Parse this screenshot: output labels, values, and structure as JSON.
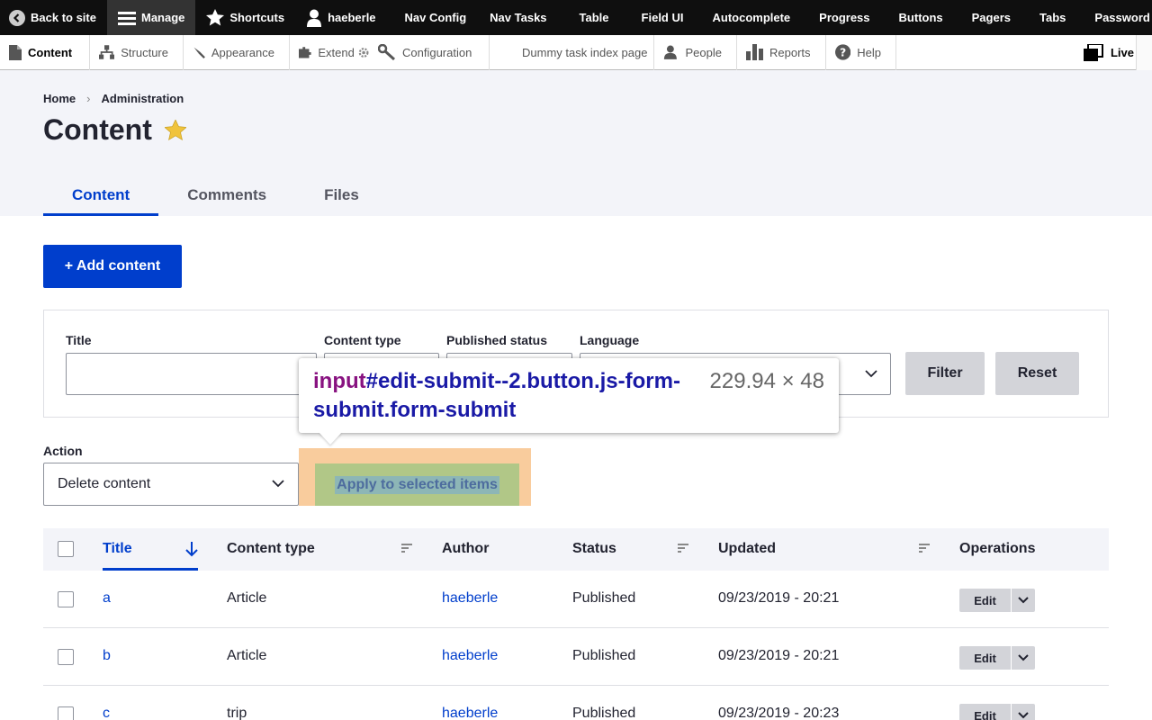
{
  "toolbar": {
    "back_to_site": "Back to site",
    "manage": "Manage",
    "shortcuts": "Shortcuts",
    "user": "haeberle",
    "nav_config": "Nav Config",
    "nav_tasks": "Nav Tasks",
    "table": "Table",
    "field_ui": "Field UI",
    "autocomplete": "Autocomplete",
    "progress": "Progress",
    "buttons": "Buttons",
    "pagers": "Pagers",
    "tabs": "Tabs",
    "password": "Password"
  },
  "tray": {
    "content": "Content",
    "structure": "Structure",
    "appearance": "Appearance",
    "extend": "Extend",
    "configuration": "Configuration",
    "dummy": "Dummy task index page",
    "people": "People",
    "reports": "Reports",
    "help": "Help",
    "live": "Live"
  },
  "breadcrumb": {
    "home": "Home",
    "sep": "›",
    "admin": "Administration"
  },
  "page_title": "Content",
  "tabs": {
    "content": "Content",
    "comments": "Comments",
    "files": "Files"
  },
  "add_content": "+ Add content",
  "filters": {
    "title_label": "Title",
    "type_label": "Content type",
    "status_label": "Published status",
    "language_label": "Language",
    "filter_btn": "Filter",
    "reset_btn": "Reset"
  },
  "action": {
    "label": "Action",
    "selected": "Delete content",
    "apply": "Apply to selected items"
  },
  "tooltip": {
    "tag": "input",
    "selector": "#edit-submit--2.button.js-form-submit.form-submit",
    "dimensions": "229.94 × 48"
  },
  "table": {
    "headers": {
      "title": "Title",
      "type": "Content type",
      "author": "Author",
      "status": "Status",
      "updated": "Updated",
      "operations": "Operations"
    },
    "rows": [
      {
        "title": "a",
        "type": "Article",
        "author": "haeberle",
        "status": "Published",
        "updated": "09/23/2019 - 20:21",
        "op": "Edit"
      },
      {
        "title": "b",
        "type": "Article",
        "author": "haeberle",
        "status": "Published",
        "updated": "09/23/2019 - 20:21",
        "op": "Edit"
      },
      {
        "title": "c",
        "type": "trip",
        "author": "haeberle",
        "status": "Published",
        "updated": "09/23/2019 - 20:23",
        "op": "Edit"
      }
    ]
  },
  "colors": {
    "primary": "#003ecc",
    "toolbar_bg": "#0f0f0f",
    "header_bg": "#f3f4f9"
  }
}
